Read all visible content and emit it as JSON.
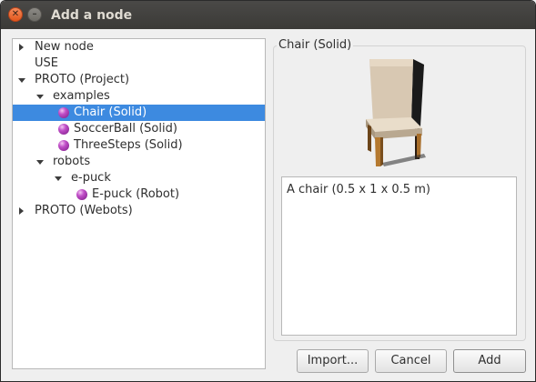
{
  "window": {
    "title": "Add a node"
  },
  "tree": [
    {
      "label": "New node",
      "indent": 0,
      "arrow": "right",
      "icon": "",
      "selected": false
    },
    {
      "label": "USE",
      "indent": 0,
      "arrow": "",
      "icon": "",
      "selected": false
    },
    {
      "label": "PROTO (Project)",
      "indent": 0,
      "arrow": "down",
      "icon": "",
      "selected": false
    },
    {
      "label": "examples",
      "indent": 1,
      "arrow": "down",
      "icon": "",
      "selected": false
    },
    {
      "label": "Chair (Solid)",
      "indent": 2,
      "arrow": "",
      "icon": "proto-node-icon",
      "selected": true
    },
    {
      "label": "SoccerBall (Solid)",
      "indent": 2,
      "arrow": "",
      "icon": "proto-node-icon",
      "selected": false
    },
    {
      "label": "ThreeSteps (Solid)",
      "indent": 2,
      "arrow": "",
      "icon": "proto-node-icon",
      "selected": false
    },
    {
      "label": "robots",
      "indent": 1,
      "arrow": "down",
      "icon": "",
      "selected": false
    },
    {
      "label": "e-puck",
      "indent": 2,
      "arrow": "down",
      "icon": "",
      "selected": false
    },
    {
      "label": "E-puck (Robot)",
      "indent": 3,
      "arrow": "",
      "icon": "proto-node-icon",
      "selected": false
    },
    {
      "label": "PROTO (Webots)",
      "indent": 0,
      "arrow": "right",
      "icon": "",
      "selected": false
    }
  ],
  "info": {
    "title": "Chair (Solid)",
    "preview_icon": "chair-preview-image",
    "description": "A chair (0.5 x 1 x 0.5 m)"
  },
  "buttons": {
    "import": "Import...",
    "cancel": "Cancel",
    "add": "Add"
  }
}
